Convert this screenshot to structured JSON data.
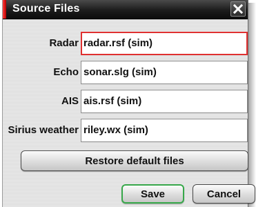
{
  "dialog": {
    "title": "Source Files",
    "close_icon": "close-icon"
  },
  "fields": [
    {
      "label": "Radar",
      "value": "radar.rsf (sim)",
      "focused": true
    },
    {
      "label": "Echo",
      "value": "sonar.slg (sim)",
      "focused": false
    },
    {
      "label": "AIS",
      "value": "ais.rsf (sim)",
      "focused": false
    },
    {
      "label": "Sirius weather",
      "value": "riley.wx (sim)",
      "focused": false
    }
  ],
  "buttons": {
    "restore_label": "Restore default files",
    "save_label": "Save",
    "cancel_label": "Cancel"
  },
  "colors": {
    "accent": "#e01b1b",
    "focus_border": "#e03030",
    "save_border": "#37a84a",
    "titlebar": "#1c1c1c"
  }
}
